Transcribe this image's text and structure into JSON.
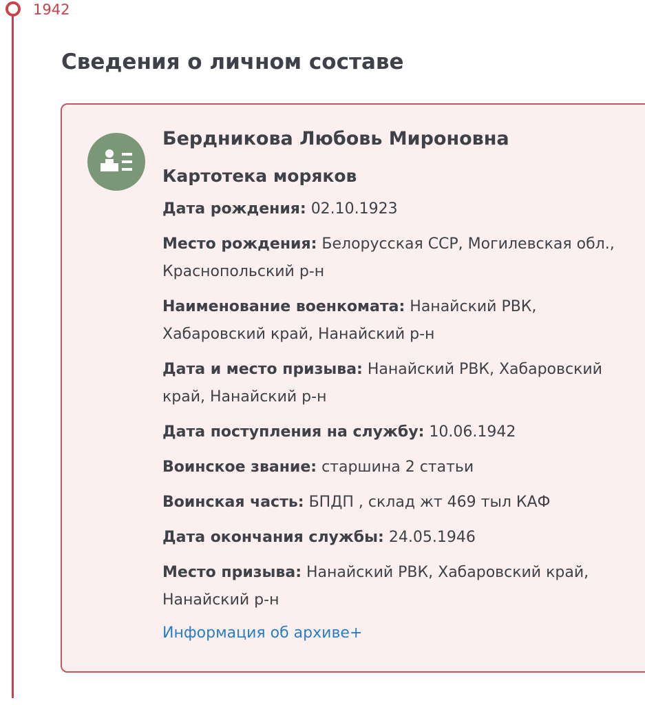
{
  "timeline": {
    "year": "1942"
  },
  "section": {
    "title": "Сведения о личном составе"
  },
  "card": {
    "name": "Бердникова Любовь Мироновна",
    "source": "Картотека моряков",
    "icon": "person-list-icon",
    "fields": [
      {
        "label": "Дата рождения:",
        "value": "02.10.1923"
      },
      {
        "label": "Место рождения:",
        "value": "Белорусская ССР, Могилевская обл., Краснопольский р-н"
      },
      {
        "label": "Наименование военкомата:",
        "value": "Нанайский РВК, Хабаровский край, Нанайский р-н"
      },
      {
        "label": "Дата и место призыва:",
        "value": "Нанайский РВК, Хабаровский край, Нанайский р-н"
      },
      {
        "label": "Дата поступления на службу:",
        "value": "10.06.1942"
      },
      {
        "label": "Воинское звание:",
        "value": "старшина 2 статьи"
      },
      {
        "label": "Воинская часть:",
        "value": "БПДП , склад жт 469 тыл КАФ"
      },
      {
        "label": "Дата окончания службы:",
        "value": "24.05.1946"
      },
      {
        "label": "Место призыва:",
        "value": "Нанайский РВК, Хабаровский край, Нанайский р-н"
      }
    ],
    "archive_link": "Информация об архиве+"
  },
  "colors": {
    "accent": "#c8434b",
    "card_background": "#fbefef",
    "card_border": "#c2575c",
    "avatar_background": "#7a9877",
    "link": "#2a7ec2",
    "text": "#3e4248"
  }
}
